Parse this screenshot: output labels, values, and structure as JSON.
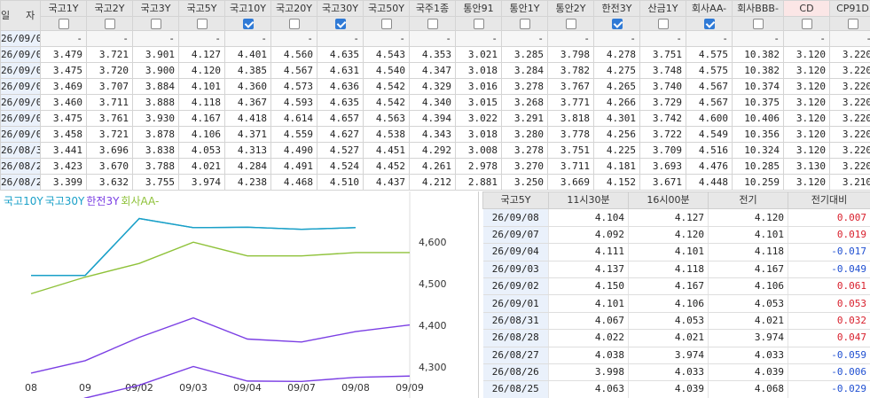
{
  "top_table": {
    "date_header": "일자",
    "columns": [
      {
        "label": "국고1Y",
        "checked": false
      },
      {
        "label": "국고2Y",
        "checked": false
      },
      {
        "label": "국고3Y",
        "checked": false
      },
      {
        "label": "국고5Y",
        "checked": false
      },
      {
        "label": "국고10Y",
        "checked": true
      },
      {
        "label": "국고20Y",
        "checked": false
      },
      {
        "label": "국고30Y",
        "checked": true
      },
      {
        "label": "국고50Y",
        "checked": false
      },
      {
        "label": "국주1종",
        "checked": false
      },
      {
        "label": "통안91",
        "checked": false
      },
      {
        "label": "통안1Y",
        "checked": false
      },
      {
        "label": "통안2Y",
        "checked": false
      },
      {
        "label": "한전3Y",
        "checked": true
      },
      {
        "label": "산금1Y",
        "checked": false
      },
      {
        "label": "회사AA-",
        "checked": true
      },
      {
        "label": "회사BBB-",
        "checked": false
      },
      {
        "label": "CD",
        "checked": false
      },
      {
        "label": "CP91D",
        "checked": false
      }
    ],
    "rows": [
      {
        "date": "26/09/09",
        "values": [
          "-",
          "-",
          "-",
          "-",
          "-",
          "-",
          "-",
          "-",
          "-",
          "-",
          "-",
          "-",
          "-",
          "-",
          "-",
          "-",
          "-",
          "-"
        ]
      },
      {
        "date": "26/09/08",
        "values": [
          "3.479",
          "3.721",
          "3.901",
          "4.127",
          "4.401",
          "4.560",
          "4.635",
          "4.543",
          "4.353",
          "3.021",
          "3.285",
          "3.798",
          "4.278",
          "3.751",
          "4.575",
          "10.382",
          "3.120",
          "3.220"
        ]
      },
      {
        "date": "26/09/07",
        "values": [
          "3.475",
          "3.720",
          "3.900",
          "4.120",
          "4.385",
          "4.567",
          "4.631",
          "4.540",
          "4.347",
          "3.018",
          "3.284",
          "3.782",
          "4.275",
          "3.748",
          "4.575",
          "10.382",
          "3.120",
          "3.220"
        ]
      },
      {
        "date": "26/09/04",
        "values": [
          "3.469",
          "3.707",
          "3.884",
          "4.101",
          "4.360",
          "4.573",
          "4.636",
          "4.542",
          "4.329",
          "3.016",
          "3.278",
          "3.767",
          "4.265",
          "3.740",
          "4.567",
          "10.374",
          "3.120",
          "3.220"
        ]
      },
      {
        "date": "26/09/03",
        "values": [
          "3.460",
          "3.711",
          "3.888",
          "4.118",
          "4.367",
          "4.593",
          "4.635",
          "4.542",
          "4.340",
          "3.015",
          "3.268",
          "3.771",
          "4.266",
          "3.729",
          "4.567",
          "10.375",
          "3.120",
          "3.220"
        ]
      },
      {
        "date": "26/09/02",
        "values": [
          "3.475",
          "3.761",
          "3.930",
          "4.167",
          "4.418",
          "4.614",
          "4.657",
          "4.563",
          "4.394",
          "3.022",
          "3.291",
          "3.818",
          "4.301",
          "3.742",
          "4.600",
          "10.406",
          "3.120",
          "3.220"
        ]
      },
      {
        "date": "26/09/01",
        "values": [
          "3.458",
          "3.721",
          "3.878",
          "4.106",
          "4.371",
          "4.559",
          "4.627",
          "4.538",
          "4.343",
          "3.018",
          "3.280",
          "3.778",
          "4.256",
          "3.722",
          "4.549",
          "10.356",
          "3.120",
          "3.220"
        ]
      },
      {
        "date": "26/08/31",
        "values": [
          "3.441",
          "3.696",
          "3.838",
          "4.053",
          "4.313",
          "4.490",
          "4.527",
          "4.451",
          "4.292",
          "3.008",
          "3.278",
          "3.751",
          "4.225",
          "3.709",
          "4.516",
          "10.324",
          "3.120",
          "3.220"
        ]
      },
      {
        "date": "26/08/28",
        "values": [
          "3.423",
          "3.670",
          "3.788",
          "4.021",
          "4.284",
          "4.491",
          "4.524",
          "4.452",
          "4.261",
          "2.978",
          "3.270",
          "3.711",
          "4.181",
          "3.693",
          "4.476",
          "10.285",
          "3.130",
          "3.220"
        ]
      },
      {
        "date": "26/08/27",
        "values": [
          "3.399",
          "3.632",
          "3.755",
          "3.974",
          "4.238",
          "4.468",
          "4.510",
          "4.437",
          "4.212",
          "2.881",
          "3.250",
          "3.669",
          "4.152",
          "3.671",
          "4.448",
          "10.259",
          "3.120",
          "3.210"
        ]
      }
    ]
  },
  "chart_data": {
    "type": "line",
    "title": "",
    "legend_position": "top-left",
    "x": [
      "08",
      "09",
      "09/02",
      "09/03",
      "09/04",
      "09/07",
      "09/08",
      "09/09"
    ],
    "x_tick_labels": [
      "08",
      "09",
      "09/02",
      "09/03",
      "09/04",
      "09/07",
      "09/08",
      "09/09"
    ],
    "y_ticks": [
      "4,600",
      "4,500",
      "4,400",
      "4,300"
    ],
    "ylim": [
      4.27,
      4.705
    ],
    "grid": false,
    "series": [
      {
        "name": "국고10Y",
        "color": "#1aa0c8",
        "values": [
          4.52,
          4.52,
          4.657,
          4.635,
          4.636,
          4.631,
          4.635
        ]
      },
      {
        "name": "국고30Y",
        "color": "#1aa0c8",
        "values": [
          4.52,
          4.52,
          4.657,
          4.635,
          4.636,
          4.631,
          4.635
        ]
      },
      {
        "name": "한전3Y",
        "color": "#7b3fe4",
        "values": [
          4.285,
          4.315,
          4.371,
          4.418,
          4.367,
          4.36,
          4.385,
          4.401
        ]
      },
      {
        "name": "회사AA-",
        "color": "#8fc23a",
        "values": [
          4.476,
          4.516,
          4.549,
          4.6,
          4.567,
          4.567,
          4.575,
          4.575
        ]
      },
      {
        "name": "",
        "color": "#7b3fe4",
        "values": [
          4.181,
          4.225,
          4.256,
          4.301,
          4.266,
          4.265,
          4.275,
          4.278
        ]
      }
    ]
  },
  "side_table": {
    "headers": [
      "국고5Y",
      "11시30분",
      "16시00분",
      "전기",
      "전기대비"
    ],
    "rows": [
      {
        "date": "26/09/08",
        "v1130": "4.104",
        "v1600": "4.127",
        "prev": "4.120",
        "diff": "0.007",
        "dir": "up"
      },
      {
        "date": "26/09/07",
        "v1130": "4.092",
        "v1600": "4.120",
        "prev": "4.101",
        "diff": "0.019",
        "dir": "up"
      },
      {
        "date": "26/09/04",
        "v1130": "4.111",
        "v1600": "4.101",
        "prev": "4.118",
        "diff": "-0.017",
        "dir": "down"
      },
      {
        "date": "26/09/03",
        "v1130": "4.137",
        "v1600": "4.118",
        "prev": "4.167",
        "diff": "-0.049",
        "dir": "down"
      },
      {
        "date": "26/09/02",
        "v1130": "4.150",
        "v1600": "4.167",
        "prev": "4.106",
        "diff": "0.061",
        "dir": "up"
      },
      {
        "date": "26/09/01",
        "v1130": "4.101",
        "v1600": "4.106",
        "prev": "4.053",
        "diff": "0.053",
        "dir": "up"
      },
      {
        "date": "26/08/31",
        "v1130": "4.067",
        "v1600": "4.053",
        "prev": "4.021",
        "diff": "0.032",
        "dir": "up"
      },
      {
        "date": "26/08/28",
        "v1130": "4.022",
        "v1600": "4.021",
        "prev": "3.974",
        "diff": "0.047",
        "dir": "up"
      },
      {
        "date": "26/08/27",
        "v1130": "4.038",
        "v1600": "3.974",
        "prev": "4.033",
        "diff": "-0.059",
        "dir": "down"
      },
      {
        "date": "26/08/26",
        "v1130": "3.998",
        "v1600": "4.033",
        "prev": "4.039",
        "diff": "-0.006",
        "dir": "down"
      },
      {
        "date": "26/08/25",
        "v1130": "4.063",
        "v1600": "4.039",
        "prev": "4.068",
        "diff": "-0.029",
        "dir": "down"
      }
    ]
  },
  "colors": {
    "up": "#d81e2b",
    "down": "#1f4fd1",
    "header_bg": "#e7e7e7",
    "date_bg": "#eaf1fb",
    "cd_header_bg": "#fbe6e6"
  }
}
